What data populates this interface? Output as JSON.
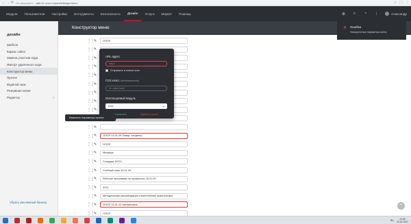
{
  "browser": {
    "secure_note": "Не защищено",
    "url": "сайт12.ucoz.ru/panel/design/menu",
    "nav_arrows": "← → ⟳"
  },
  "topnav": {
    "items": [
      "Модули",
      "Пользователи",
      "Настройки",
      "Инструменты",
      "Безопасность",
      "Дизайн",
      "Услуги",
      "Маркет",
      "Помощь"
    ],
    "active_index": 5,
    "user_name": "Александр"
  },
  "sidebar": {
    "title": "дизайн",
    "items": [
      {
        "label": "Шаблон"
      },
      {
        "label": "Каркас сайта"
      },
      {
        "label": "Замена участков кода"
      },
      {
        "label": "Импорт удаленного кода"
      },
      {
        "label": "Конструктор меню",
        "active": true
      },
      {
        "label": "Прочее"
      },
      {
        "label": "Водяной знак"
      },
      {
        "label": "Резервная копия"
      },
      {
        "label": "Редактор",
        "chevron": "›"
      }
    ],
    "banner_link": "Убрать рекламный баннер"
  },
  "main": {
    "title": "Конструктор меню"
  },
  "menu_items": [
    {
      "label": "ОПОП"
    },
    {
      "label": ""
    },
    {
      "label": ""
    },
    {
      "label": ""
    },
    {
      "label": ""
    },
    {
      "label": ""
    },
    {
      "label": ""
    },
    {
      "label": ""
    },
    {
      "label": ""
    },
    {
      "label": ""
    },
    {
      "label": ""
    },
    {
      "label": "ОПОП 43.01.09 Повар, кондитер",
      "error": true
    },
    {
      "label": "ОПОП"
    },
    {
      "label": "Матрица"
    },
    {
      "label": "Стандарт ФГОС"
    },
    {
      "label": "Учебный план 43.01.09"
    },
    {
      "label": "Рабочие программы по профессии 43.01.09"
    },
    {
      "label": "ФОС"
    },
    {
      "label": "Методические рекомендации к выполнению практических"
    },
    {
      "label": "ОПОП 23.01.03 Автомеханик",
      "error": true
    },
    {
      "label": "ОПОП"
    }
  ],
  "popup": {
    "url_label": "URL адрес",
    "url_placeholder": "http://",
    "new_window_label": "Открывать в новом окне",
    "css_label": "CSS класс",
    "css_sub": "(необязательно)",
    "css_placeholder": "ex: class-name",
    "module_label": "Используемый модуль",
    "module_value": "Блог",
    "module_arrow": "▾",
    "save_label": "Сохранить",
    "delete_label": "Удалить пункт"
  },
  "tooltip": {
    "text": "Изменить параметры пункта"
  },
  "toast": {
    "title": "Ошибка",
    "message": "Некорректные параметры меню",
    "icon": "✕"
  },
  "taskbar": {
    "lang": "RU",
    "time": "23:59",
    "date": "30.01.2022",
    "apps": [
      {
        "name": "windows-app",
        "color": "#1e6fd0"
      },
      {
        "name": "app-red",
        "color": "#c62828"
      },
      {
        "name": "app-red-2",
        "color": "#b71c1c"
      },
      {
        "name": "app-orange",
        "color": "#ef6c00"
      },
      {
        "name": "chrome-app",
        "color": "#34a853"
      },
      {
        "name": "app-yellow",
        "color": "#f9a825"
      },
      {
        "name": "app-orange-2",
        "color": "#ff7043"
      },
      {
        "name": "app-yandex",
        "color": "#e53935"
      },
      {
        "name": "app-blue",
        "color": "#1565c0"
      },
      {
        "name": "app-teal",
        "color": "#00897b"
      },
      {
        "name": "app-viber",
        "color": "#6a1b9a"
      },
      {
        "name": "app-word",
        "color": "#1e88e5"
      }
    ]
  }
}
